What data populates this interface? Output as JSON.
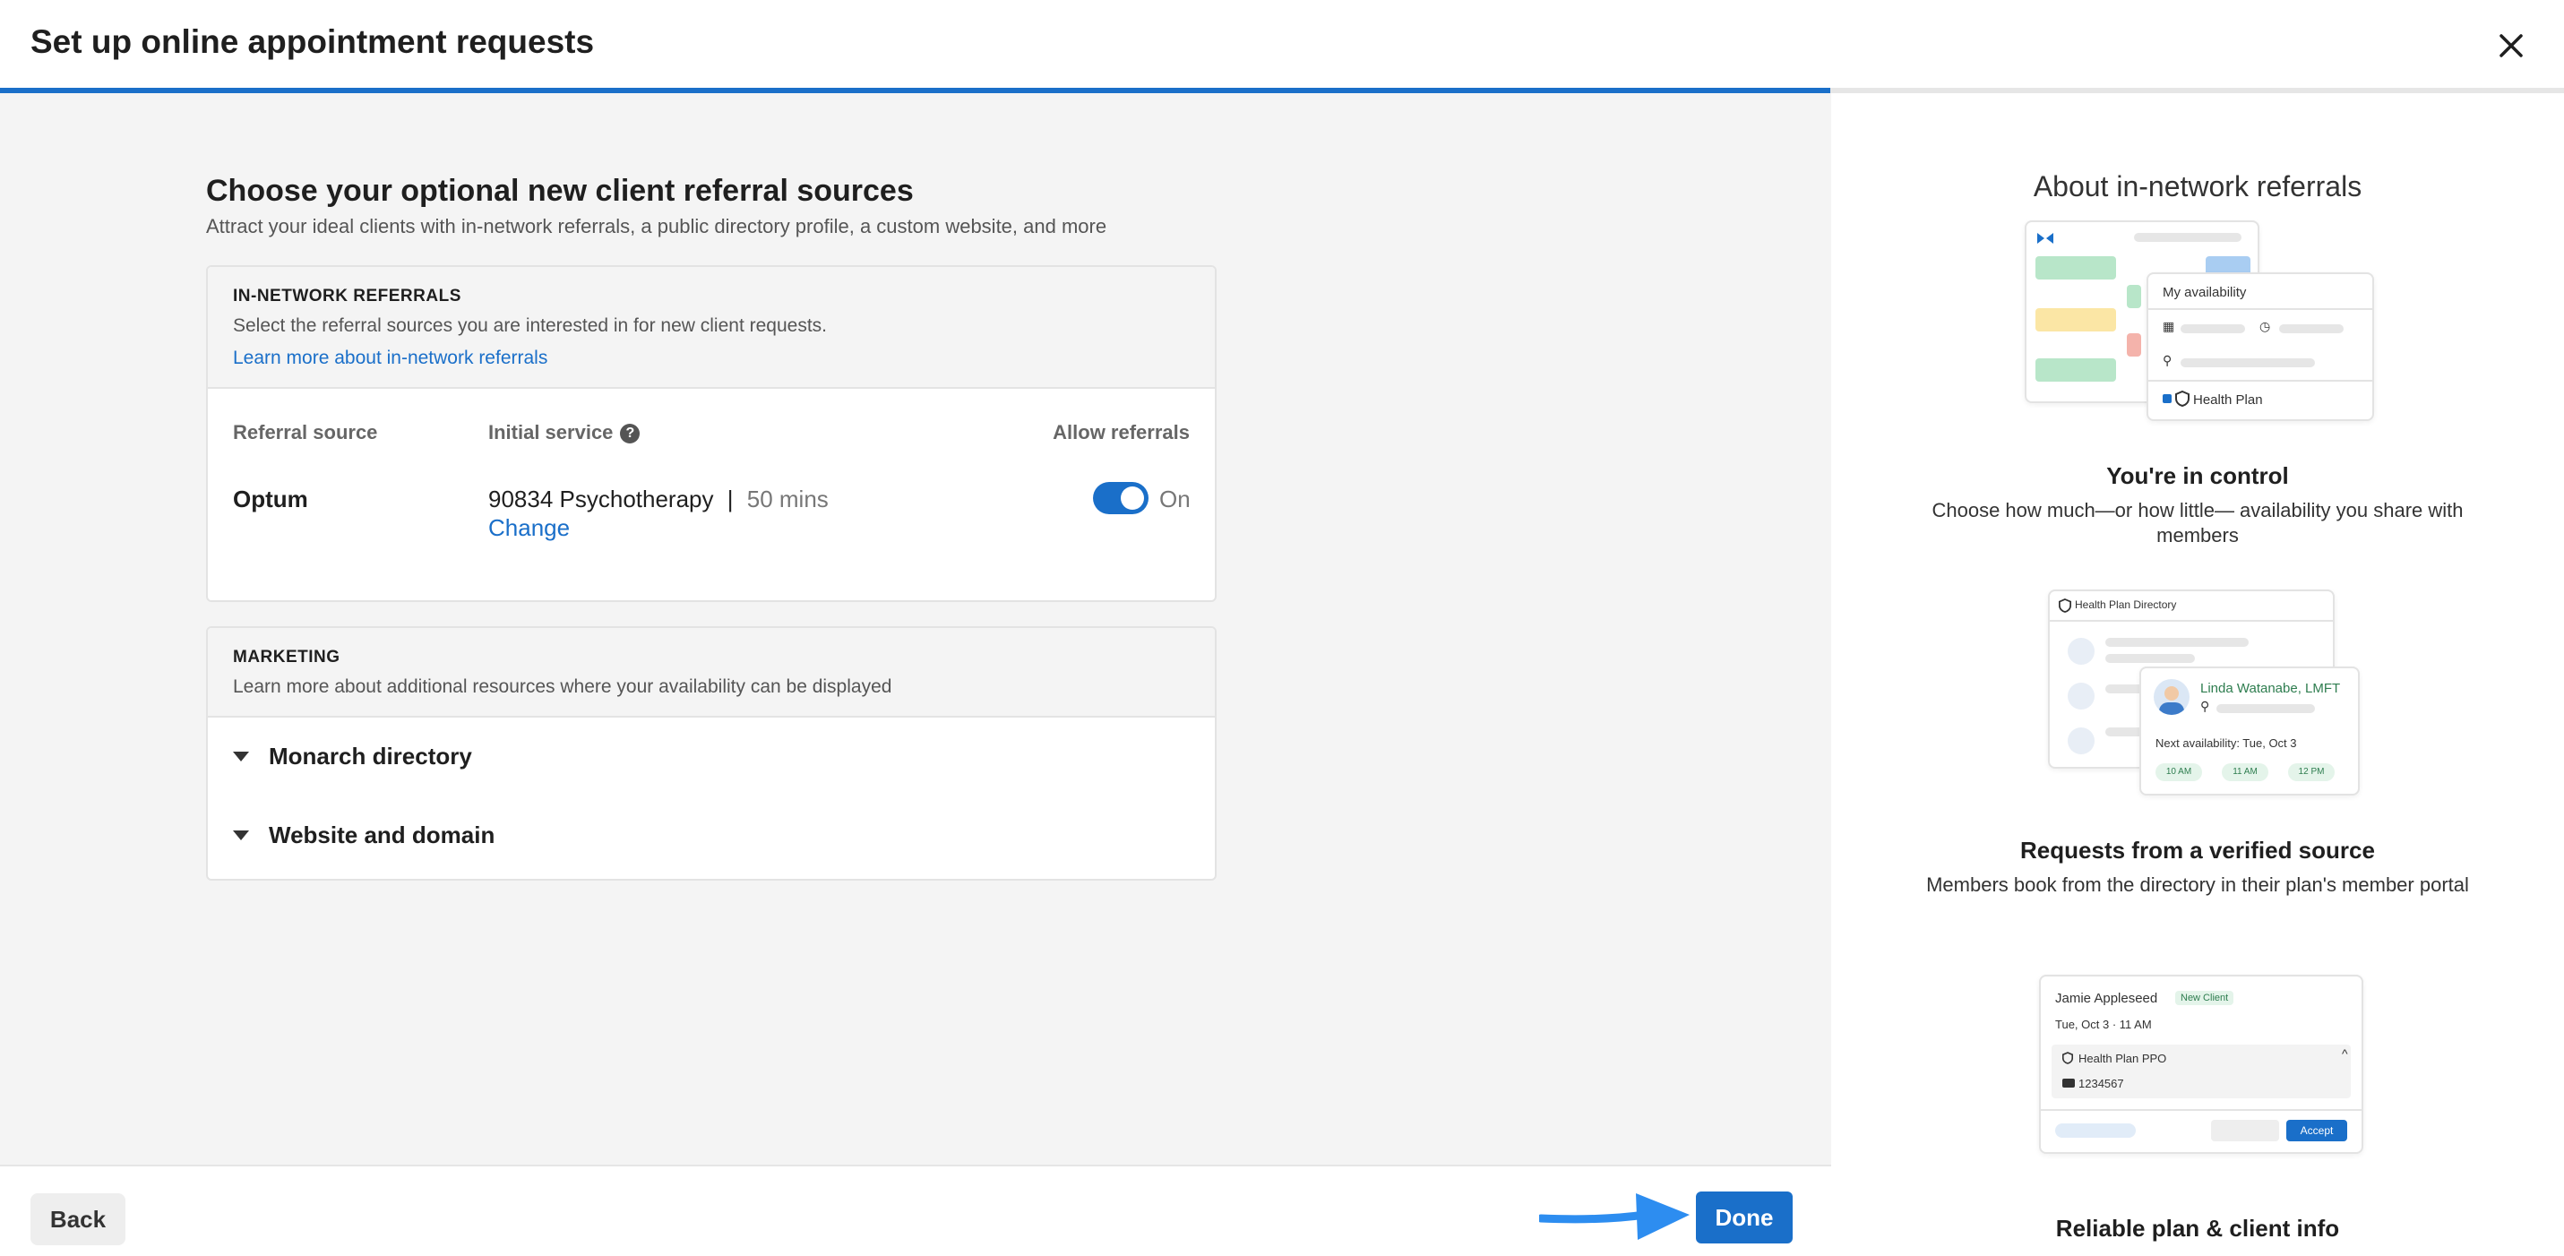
{
  "header": {
    "title": "Set up online appointment requests",
    "close_icon": "close-icon",
    "progress_fraction": 0.714
  },
  "main": {
    "title": "Choose your optional new client referral sources",
    "subtitle": "Attract your ideal clients with in-network referrals, a public directory profile, a custom website, and more",
    "in_network": {
      "kicker": "IN-NETWORK REFERRALS",
      "description": "Select the referral sources you are interested in for new client requests.",
      "link": "Learn more about in-network referrals",
      "columns": {
        "source": "Referral source",
        "service": "Initial service",
        "allow": "Allow referrals"
      },
      "help_icon": "question-circle-icon",
      "row": {
        "source": "Optum",
        "service_code": "90834 Psychotherapy",
        "separator": "|",
        "duration": "50 mins",
        "change_label": "Change",
        "toggle_state": "On"
      }
    },
    "marketing": {
      "kicker": "MARKETING",
      "description": "Learn more about additional resources where your availability can be displayed",
      "items": [
        "Monarch directory",
        "Website and domain"
      ]
    }
  },
  "footer": {
    "back_label": "Back",
    "done_label": "Done"
  },
  "aside": {
    "title": "About in-network referrals",
    "features": [
      {
        "title": "You're in control",
        "text": "Choose how much—or how little— availability you share with members",
        "illustration": {
          "availability_label": "My availability",
          "health_plan_label": "Health Plan"
        }
      },
      {
        "title": "Requests from a verified source",
        "text": "Members book from the directory in their plan's member portal",
        "illustration": {
          "directory_label": "Health Plan Directory",
          "provider_name": "Linda Watanabe, LMFT",
          "next_availability": "Next availability: Tue, Oct 3",
          "slots": [
            "10 AM",
            "11 AM",
            "12 PM"
          ]
        }
      },
      {
        "title": "Reliable plan & client info",
        "illustration": {
          "client_name": "Jamie Appleseed",
          "badge": "New Client",
          "datetime": "Tue, Oct 3 · 11 AM",
          "plan": "Health Plan PPO",
          "member_id": "1234567",
          "accept_label": "Accept"
        }
      }
    ]
  },
  "colors": {
    "brand_blue": "#1a6fc9",
    "page_bg": "#f4f4f4",
    "success_green": "#2e7d4f",
    "arrow_blue": "#2d8df0"
  }
}
